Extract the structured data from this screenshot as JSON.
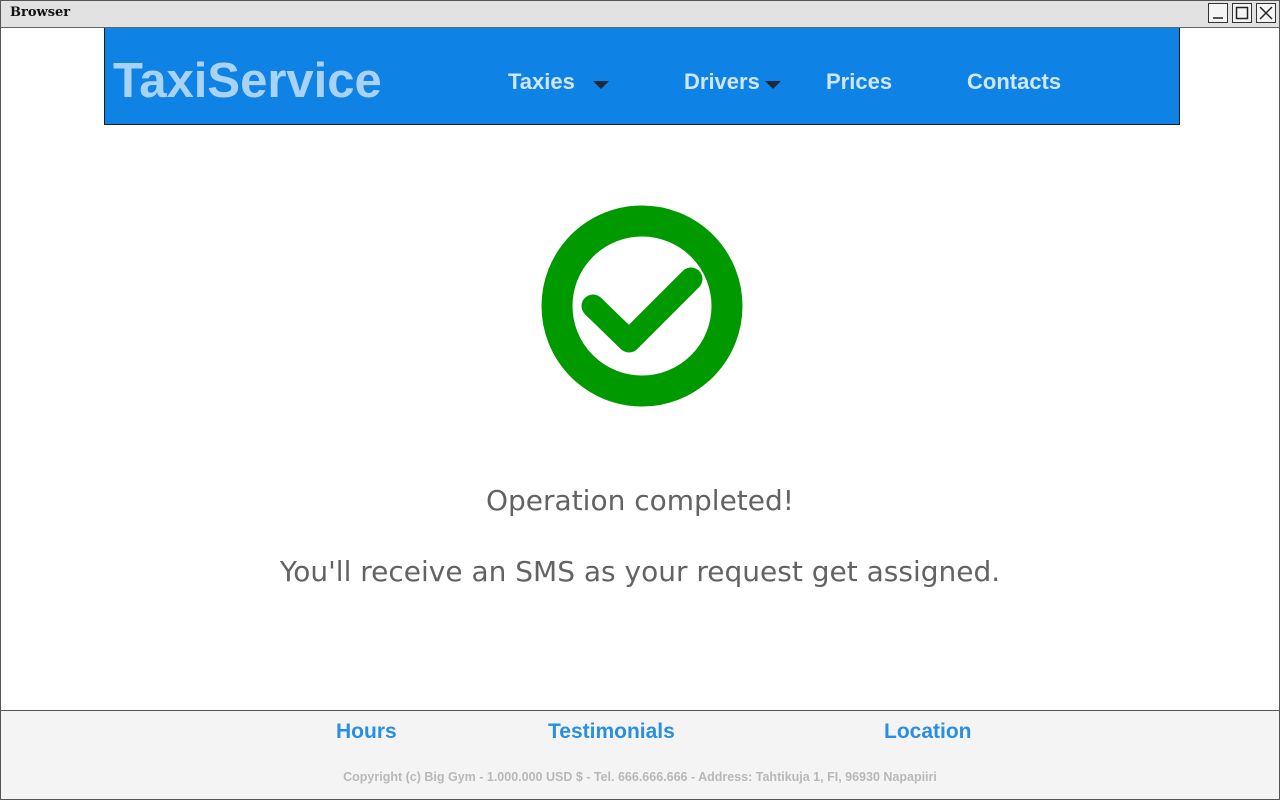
{
  "window": {
    "title": "Browser",
    "icons": [
      "minimize-icon",
      "maximize-icon",
      "close-icon"
    ]
  },
  "header": {
    "logo": "TaxiService",
    "nav": [
      {
        "label": "Taxies",
        "has_dropdown": true
      },
      {
        "label": "Drivers",
        "has_dropdown": true
      },
      {
        "label": "Prices",
        "has_dropdown": false
      },
      {
        "label": "Contacts",
        "has_dropdown": false
      }
    ],
    "bg_color": "#0f83e5"
  },
  "main": {
    "status_icon": "check-circle-icon",
    "status_color": "#009900",
    "heading": "Operation completed!",
    "message": "You'll receive an SMS as your request get assigned."
  },
  "footer": {
    "links": [
      "Hours",
      "Testimonials",
      "Location"
    ],
    "copyright": "Copyright (c) Big Gym - 1.000.000 USD $ - Tel. 666.666.666 - Address: Tahtikuja 1, FI, 96930 Napapiiri"
  }
}
